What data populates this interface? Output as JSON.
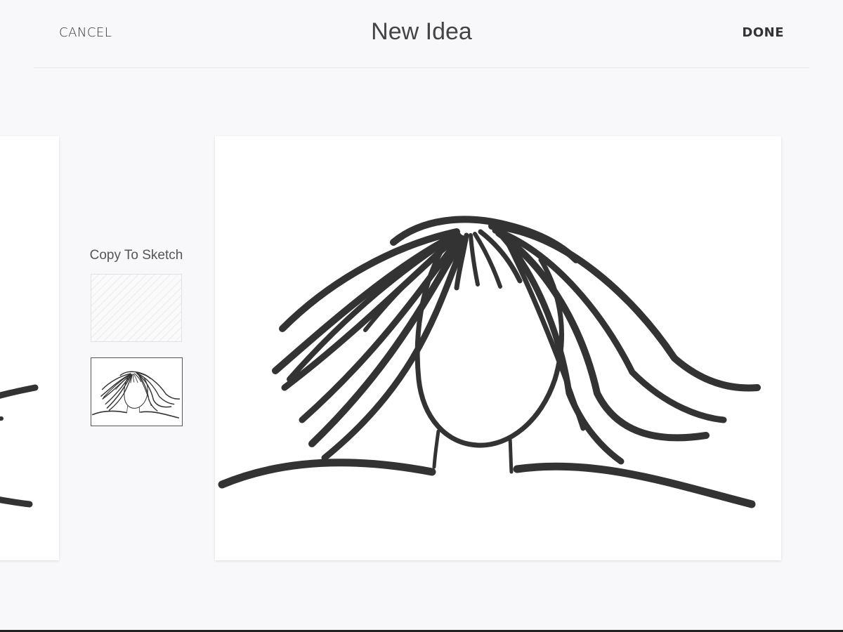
{
  "header": {
    "cancel_label": "CANCEL",
    "title": "New Idea",
    "done_label": "DONE"
  },
  "side_panel": {
    "copy_label": "Copy To Sketch"
  },
  "colors": {
    "background": "#f8f8fa",
    "ink": "#333333",
    "card": "#ffffff"
  }
}
